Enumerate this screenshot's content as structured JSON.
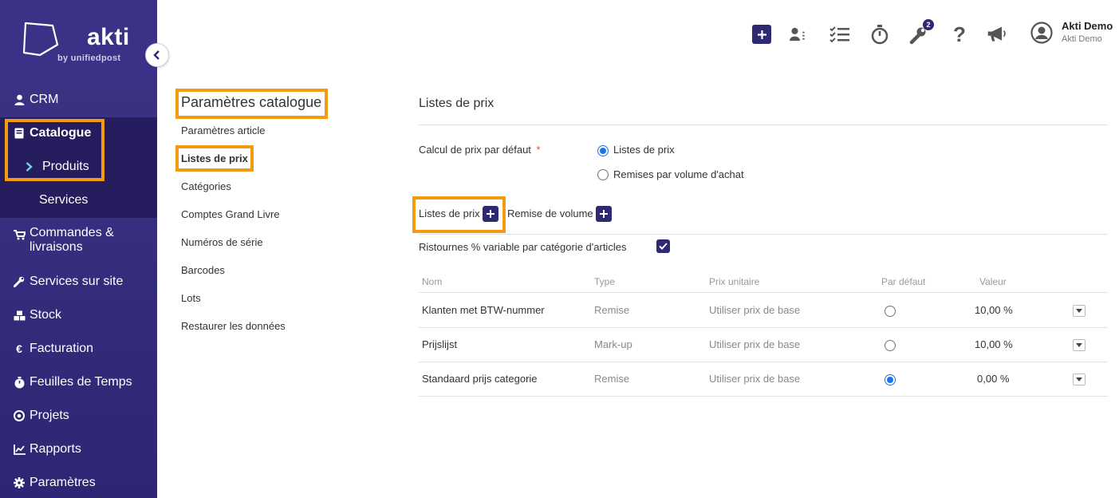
{
  "brand": {
    "name": "akti",
    "sub": "by unifiedpost"
  },
  "sidebar": {
    "items": [
      {
        "label": "CRM",
        "icon": "user-icon"
      },
      {
        "label": "Catalogue",
        "icon": "book-icon"
      },
      {
        "label": "Produits",
        "icon": "chevron-right-icon"
      },
      {
        "label": "Services"
      },
      {
        "label": "Commandes &",
        "label2": "livraisons",
        "icon": "cart-icon"
      },
      {
        "label": "Services sur site",
        "icon": "wrench-icon"
      },
      {
        "label": "Stock",
        "icon": "cubes-icon"
      },
      {
        "label": "Facturation",
        "icon": "euro-icon"
      },
      {
        "label": "Feuilles de Temps",
        "icon": "stopwatch-icon"
      },
      {
        "label": "Projets",
        "icon": "target-icon"
      },
      {
        "label": "Rapports",
        "icon": "chart-icon"
      },
      {
        "label": "Paramètres",
        "icon": "gear-icon"
      }
    ]
  },
  "topbar": {
    "badge_count": "2",
    "user_name": "Akti Demo",
    "user_company": "Akti Demo"
  },
  "subnav": {
    "title": "Paramètres catalogue",
    "links": [
      "Paramètres article",
      "Listes de prix",
      "Catégories",
      "Comptes Grand Livre",
      "Numéros de série",
      "Barcodes",
      "Lots",
      "Restaurer les données"
    ]
  },
  "main": {
    "title": "Listes de prix",
    "calc_label": "Calcul de prix par défaut",
    "required_mark": "*",
    "radio_options": [
      "Listes de prix",
      "Remises par volume d'achat"
    ],
    "tab_price_lists": "Listes de prix",
    "tab_volume": "Remise de volume",
    "rebate_label": "Ristournes % variable par catégorie d'articles",
    "table": {
      "headers": [
        "Nom",
        "Type",
        "Prix unitaire",
        "Par défaut",
        "Valeur"
      ],
      "rows": [
        {
          "name": "Klanten met BTW-nummer",
          "type": "Remise",
          "unit": "Utiliser prix de base",
          "default": false,
          "value": "10,00 %"
        },
        {
          "name": "Prijslijst",
          "type": "Mark-up",
          "unit": "Utiliser prix de base",
          "default": false,
          "value": "10,00 %"
        },
        {
          "name": "Standaard prijs categorie",
          "type": "Remise",
          "unit": "Utiliser prix de base",
          "default": true,
          "value": "0,00 %"
        }
      ]
    }
  },
  "colors": {
    "sidebar": "#3d3486",
    "accent": "#2f2873",
    "highlight": "#f39c12",
    "radio": "#1a73e8"
  }
}
